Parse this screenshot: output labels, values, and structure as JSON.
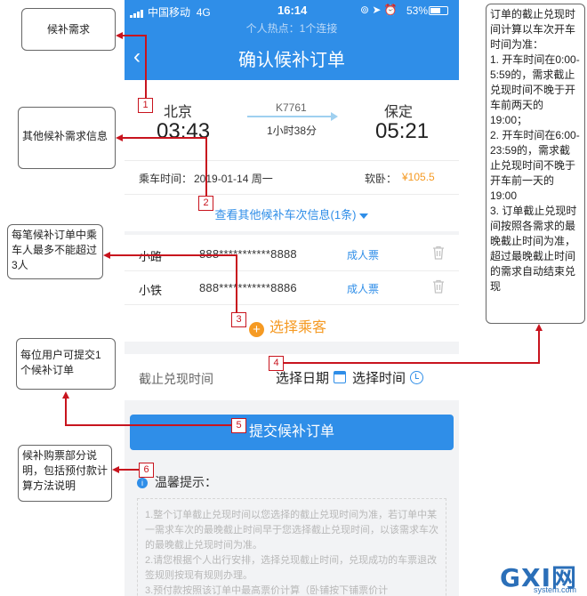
{
  "status_bar": {
    "carrier": "中国移动",
    "network": "4G",
    "time": "16:14",
    "battery": "53%"
  },
  "hotspot_text": "个人热点：1个连接",
  "nav": {
    "back_icon": "‹",
    "title": "确认候补订单"
  },
  "train": {
    "from_city": "北京",
    "from_time": "03:43",
    "train_no": "K7761",
    "duration": "1小时38分",
    "to_city": "保定",
    "to_time": "05:21",
    "depart_label": "乘车时间：",
    "depart_date": "2019-01-14 周一",
    "seat_type": "软卧：",
    "price": "¥105.5",
    "other_trains_link": "查看其他候补车次信息(1条)"
  },
  "passengers": [
    {
      "name": "小路",
      "id": "888***********8888",
      "ticket_type": "成人票"
    },
    {
      "name": "小铁",
      "id": "888***********8886",
      "ticket_type": "成人票"
    }
  ],
  "select_passenger": {
    "icon": "+",
    "label": "选择乘客"
  },
  "deadline": {
    "label": "截止兑现时间",
    "date_picker": "选择日期",
    "time_picker": "选择时间"
  },
  "submit_button": "提交候补订单",
  "tips": {
    "title": "温馨提示：",
    "info_icon": "i",
    "lines": [
      "1.整个订单截止兑现时间以您选择的截止兑现时间为准，若订单中某一需求车次的最晚截止时间早于您选择截止兑现时间，以该需求车次的最晚截止兑现时间为准。",
      "2.请您根据个人出行安排，选择兑现截止时间，兑现成功的车票退改签规则按现有规则办理。",
      "3.预付款按照该订单中最高票价计算（卧铺按下铺票价计"
    ]
  },
  "annotations": [
    {
      "number": "1",
      "text": "候补需求"
    },
    {
      "number": "2",
      "text": "其他候补需求信息"
    },
    {
      "number": "3",
      "text": "每笔候补订单中乘车人最多不能超过3人"
    },
    {
      "number": "4",
      "text": "订单的截止兑现时间计算以车次开车时间为准：\n1. 开车时间在0:00-5:59的，需求截止兑现时间不晚于开车前两天的19:00；\n2. 开车时间在6:00-23:59的，需求截止兑现时间不晚于开车前一天的19:00\n3. 订单截止兑现时间按照各需求的最晚截止时间为准，超过最晚截止时间的需求自动结束兑现"
    },
    {
      "number": "5",
      "text": "每位用户可提交1个候补订单"
    },
    {
      "number": "6",
      "text": "候补购票部分说明，包括预付款计算方法说明"
    }
  ],
  "watermark": {
    "logo": "GXI网",
    "domain": "system.com"
  },
  "colors": {
    "primary": "#2f8ee8",
    "accent": "#f59a23",
    "annotation_red": "#c8141e"
  }
}
